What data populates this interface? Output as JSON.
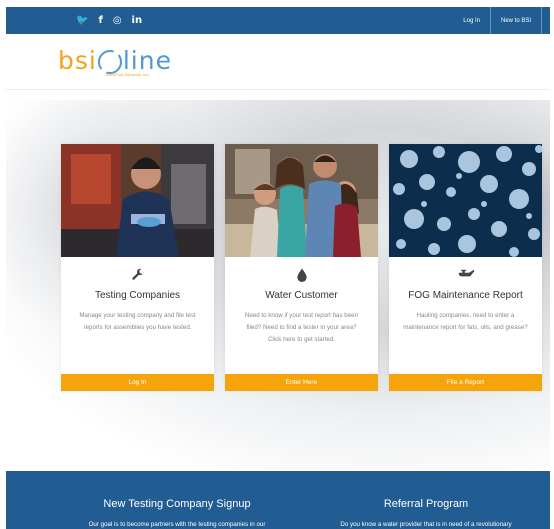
{
  "topbar": {
    "social": [
      "twitter-icon",
      "facebook-icon",
      "instagram-icon",
      "linkedin-icon"
    ],
    "social_glyphs": [
      "🐦",
      "f",
      "◎",
      "in"
    ],
    "login_label": "Log In",
    "new_label": "New to BSI"
  },
  "logo": {
    "left": "bsi",
    "right": "line",
    "tagline": "BackFlow Solutions, Inc."
  },
  "cards": [
    {
      "title": "Testing Companies",
      "description": "Manage your testing company and file test reports for assemblies you have tested.",
      "button": "Log In",
      "icon": "wrench-icon"
    },
    {
      "title": "Water Customer",
      "description": "Need to know if your test report has been filed? Need to find a tester in your area? Click here to get started.",
      "button": "Enter Here",
      "icon": "water-drop-icon"
    },
    {
      "title": "FOG Maintenance Report",
      "description": "Hauling companies, need to enter a maintenance report for fats, oils, and grease?",
      "button": "File a Report",
      "icon": "oil-can-icon"
    }
  ],
  "footer": {
    "signup_title": "New Testing Company Signup",
    "signup_text": "Our goal is to become partners with the testing companies in our",
    "referral_title": "Referral Program",
    "referral_text": "Do you know a water provider that is in need of a revolutionary"
  },
  "colors": {
    "brand_blue": "#215d92",
    "accent_orange": "#f5a50b",
    "logo_orange": "#f5a21c",
    "logo_blue": "#4d9ad6"
  }
}
